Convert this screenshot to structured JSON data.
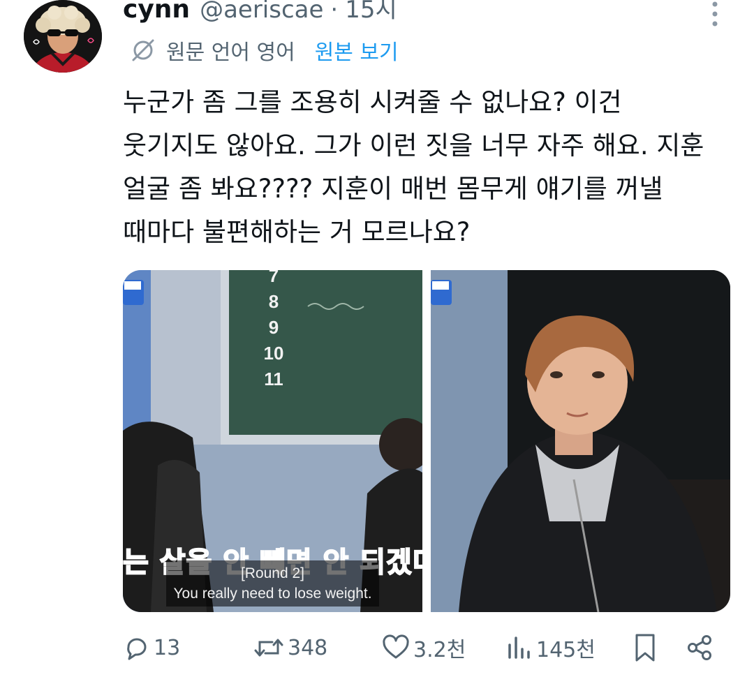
{
  "author": {
    "display_name": "cynn",
    "handle": "@aeriscae",
    "separator": "·",
    "time": "15시"
  },
  "translation": {
    "info": "원문 언어 영어",
    "show_original_label": "원본 보기"
  },
  "tweet": {
    "lines": [
      "누군가 좀 그를 조용히 시켜줄 수 없나요? 이건",
      "웃기지도 않아요. 그가 이런 짓을 너무 자주 해요. 지훈",
      "얼굴 좀 봐요???? 지훈이 매번 몸무게 얘기를 꺼낼",
      "때마다 불편해하는 거 모르나요?"
    ]
  },
  "media": {
    "left": {
      "board_numbers": [
        "7",
        "8",
        "9",
        "10",
        "11"
      ],
      "burned_subtitle": "는 살을 안 빼면 안 되겠더",
      "subtitle_line1": "[Round 2]",
      "subtitle_line2": "You really need to lose weight."
    },
    "right": {}
  },
  "actions": {
    "reply": {
      "count": "13",
      "icon": "reply-icon"
    },
    "repost": {
      "count": "348",
      "icon": "repost-icon"
    },
    "like": {
      "count": "3.2천",
      "icon": "heart-icon"
    },
    "views": {
      "count": "145천",
      "icon": "views-icon"
    },
    "bookmark": {
      "icon": "bookmark-icon"
    },
    "share": {
      "icon": "share-icon"
    }
  },
  "colors": {
    "text": "#0f1419",
    "secondary": "#536471",
    "accent": "#1d9bf0"
  }
}
